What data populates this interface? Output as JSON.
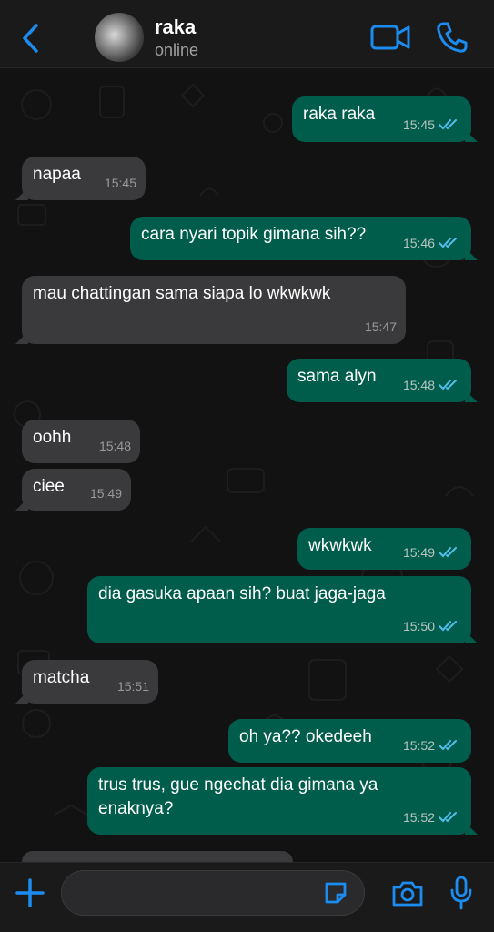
{
  "header": {
    "back_icon": "chevron-left-icon",
    "contact_name": "raka",
    "contact_status": "online",
    "video_icon": "video-camera-icon",
    "call_icon": "phone-icon"
  },
  "colors": {
    "accent": "#1d8cf0",
    "outgoing_bubble": "#005c4b",
    "incoming_bubble": "#3a3a3c",
    "read_ticks": "#53bdeb"
  },
  "messages": [
    {
      "dir": "out",
      "text": "raka raka",
      "time": "15:45",
      "read": true
    },
    {
      "dir": "in",
      "text": "napaa",
      "time": "15:45"
    },
    {
      "dir": "out",
      "text": "cara nyari topik gimana sih??",
      "time": "15:46",
      "read": true
    },
    {
      "dir": "in",
      "text": "mau chattingan sama siapa lo wkwkwk",
      "time": "15:47"
    },
    {
      "dir": "out",
      "text": "sama alyn",
      "time": "15:48",
      "read": true
    },
    {
      "dir": "in",
      "text": "oohh",
      "time": "15:48"
    },
    {
      "dir": "in",
      "text": "ciee",
      "time": "15:49"
    },
    {
      "dir": "out",
      "text": "wkwkwk",
      "time": "15:49",
      "read": true
    },
    {
      "dir": "out",
      "text": "dia gasuka apaan sih? buat jaga-jaga",
      "time": "15:50",
      "read": true
    },
    {
      "dir": "in",
      "text": "matcha",
      "time": "15:51"
    },
    {
      "dir": "out",
      "text": "oh ya?? okedeeh",
      "time": "15:52",
      "read": true
    },
    {
      "dir": "out",
      "text": "trus trus, gue ngechat dia gimana ya enaknya?",
      "time": "15:52",
      "read": true
    }
  ],
  "composer": {
    "plus_icon": "plus-icon",
    "sticker_icon": "sticker-icon",
    "camera_icon": "camera-icon",
    "mic_icon": "microphone-icon",
    "input_value": ""
  }
}
